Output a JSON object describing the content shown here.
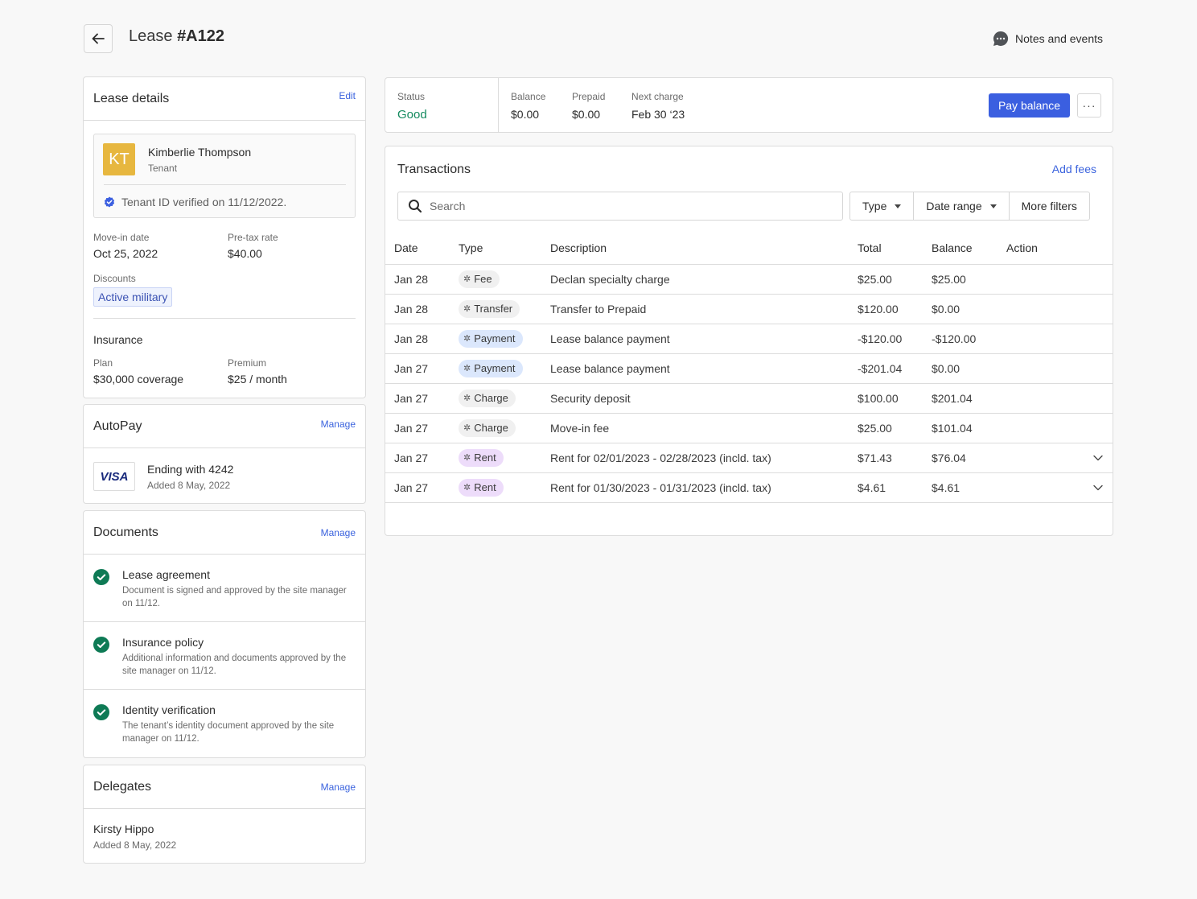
{
  "header": {
    "title_prefix": "Lease",
    "title_id": "#A122",
    "notes_label": "Notes and events"
  },
  "lease_details": {
    "title": "Lease details",
    "edit_label": "Edit",
    "tenant": {
      "initials": "KT",
      "name": "Kimberlie Thompson",
      "role": "Tenant",
      "verified_text": "Tenant ID verified on 11/12/2022."
    },
    "move_in_label": "Move-in date",
    "move_in_value": "Oct 25, 2022",
    "pretax_label": "Pre-tax rate",
    "pretax_value": "$40.00",
    "discounts_label": "Discounts",
    "discount_chip": "Active military",
    "insurance": {
      "title": "Insurance",
      "plan_label": "Plan",
      "plan_value": "$30,000 coverage",
      "premium_label": "Premium",
      "premium_value": "$25 / month"
    }
  },
  "autopay": {
    "title": "AutoPay",
    "manage_label": "Manage",
    "card_brand": "VISA",
    "card_title": "Ending with 4242",
    "card_added": "Added 8 May, 2022"
  },
  "documents": {
    "title": "Documents",
    "manage_label": "Manage",
    "items": [
      {
        "title": "Lease agreement",
        "desc": "Document is signed and approved by the site manager on 11/12."
      },
      {
        "title": "Insurance policy",
        "desc": "Additional information and documents approved by the site manager on 11/12."
      },
      {
        "title": "Identity verification",
        "desc": "The tenant’s identity document approved by the site manager on 11/12."
      }
    ]
  },
  "delegates": {
    "title": "Delegates",
    "manage_label": "Manage",
    "name": "Kirsty Hippo",
    "added": "Added 8 May, 2022"
  },
  "summary": {
    "status_label": "Status",
    "status_value": "Good",
    "balance_label": "Balance",
    "balance_value": "$0.00",
    "prepaid_label": "Prepaid",
    "prepaid_value": "$0.00",
    "next_charge_label": "Next charge",
    "next_charge_value": "Feb 30 ‘23",
    "pay_button": "Pay balance",
    "more_button": "···"
  },
  "transactions": {
    "title": "Transactions",
    "add_fees_label": "Add fees",
    "search_placeholder": "Search",
    "filters": {
      "type": "Type",
      "date_range": "Date range",
      "more": "More filters"
    },
    "columns": [
      "Date",
      "Type",
      "Description",
      "Total",
      "Balance",
      "Action"
    ],
    "rows": [
      {
        "date": "Jan 28",
        "type": "Fee",
        "chip": "gray",
        "desc": "Declan specialty charge",
        "total": "$25.00",
        "balance": "$25.00",
        "expandable": false
      },
      {
        "date": "Jan 28",
        "type": "Transfer",
        "chip": "gray",
        "desc": "Transfer to Prepaid",
        "total": "$120.00",
        "balance": "$0.00",
        "expandable": false
      },
      {
        "date": "Jan 28",
        "type": "Payment",
        "chip": "blue",
        "desc": "Lease balance payment",
        "total": "-$120.00",
        "balance": "-$120.00",
        "expandable": false
      },
      {
        "date": "Jan 27",
        "type": "Payment",
        "chip": "blue",
        "desc": "Lease balance payment",
        "total": "-$201.04",
        "balance": "$0.00",
        "expandable": false
      },
      {
        "date": "Jan 27",
        "type": "Charge",
        "chip": "gray",
        "desc": "Security deposit",
        "total": "$100.00",
        "balance": "$201.04",
        "expandable": false
      },
      {
        "date": "Jan 27",
        "type": "Charge",
        "chip": "gray",
        "desc": "Move-in fee",
        "total": "$25.00",
        "balance": "$101.04",
        "expandable": false
      },
      {
        "date": "Jan 27",
        "type": "Rent",
        "chip": "purple",
        "desc": "Rent for 02/01/2023 - 02/28/2023 (incld. tax)",
        "total": "$71.43",
        "balance": "$76.04",
        "expandable": true
      },
      {
        "date": "Jan 27",
        "type": "Rent",
        "chip": "purple",
        "desc": "Rent for 01/30/2023 - 01/31/2023  (incld. tax)",
        "total": "$4.61",
        "balance": "$4.61",
        "expandable": true
      }
    ]
  },
  "colors": {
    "accent": "#3b5fe0",
    "status_good": "#138a5e",
    "avatar": "#e7b73f",
    "check": "#0e7a55"
  }
}
